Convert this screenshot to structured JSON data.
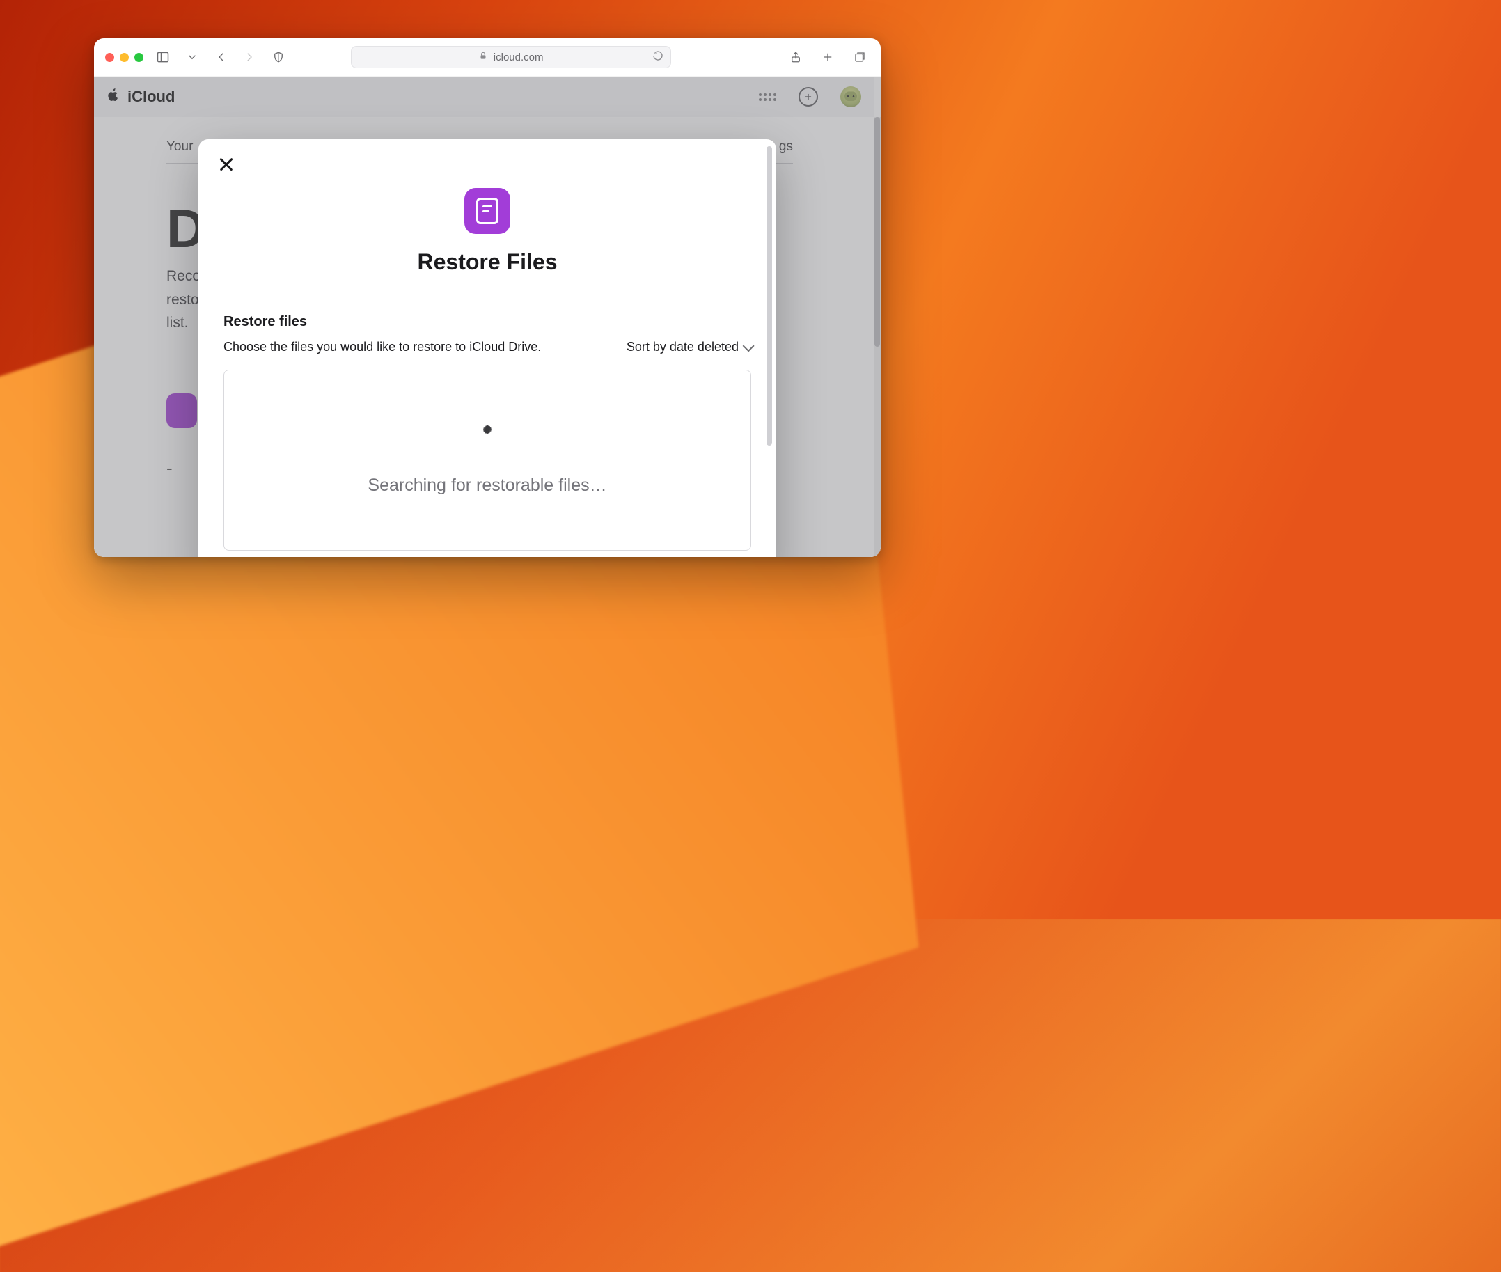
{
  "browser": {
    "url_display": "icloud.com"
  },
  "icloud_header": {
    "brand": "iCloud"
  },
  "background_page": {
    "tab_left": "Your",
    "tab_right_fragment": "gs",
    "heading_fragment": "D",
    "body_line1": "Reco",
    "body_line2": "resto",
    "body_line3": "list.",
    "dash": "-"
  },
  "modal": {
    "title": "Restore Files",
    "section_title": "Restore files",
    "description": "Choose the files you would like to restore to iCloud Drive.",
    "sort_label": "Sort by date deleted",
    "loading_text": "Searching for restorable files…"
  }
}
